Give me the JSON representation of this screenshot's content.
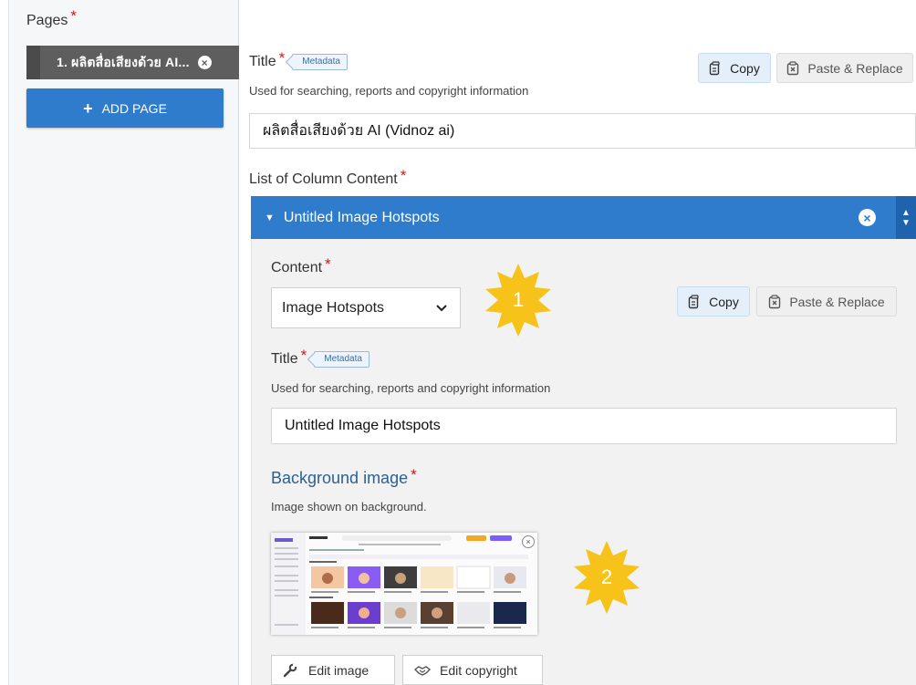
{
  "sidebar": {
    "pages_label": "Pages",
    "required_mark": "*",
    "page_items": [
      {
        "label": "1. ผลิตสื่อเสียงด้วย AI...",
        "close_icon": "×"
      }
    ],
    "add_page_icon": "+",
    "add_page_label": "ADD PAGE"
  },
  "title_field": {
    "label": "Title",
    "required_mark": "*",
    "metadata_tag": "Metadata",
    "help": "Used for searching, reports and copyright information",
    "value": "ผลิตสื่อเสียงด้วย AI (Vidnoz ai)",
    "copy_label": "Copy",
    "paste_label": "Paste & Replace"
  },
  "column_content": {
    "label": "List of Column Content",
    "required_mark": "*",
    "group_caret": "▼",
    "group_title": "Untitled Image Hotspots",
    "close_icon": "×",
    "up_icon": "▲",
    "down_icon": "▼",
    "content_label": "Content",
    "content_select_value": "Image Hotspots",
    "content_select_caret": "⌄",
    "copy_label": "Copy",
    "paste_label": "Paste & Replace",
    "title_label": "Title",
    "metadata_tag": "Metadata",
    "title_help": "Used for searching, reports and copyright information",
    "title_value": "Untitled Image Hotspots",
    "bg_label": "Background image",
    "bg_help": "Image shown on background.",
    "thumb_close": "×",
    "edit_image_label": "Edit image",
    "edit_copyright_label": "Edit copyright"
  },
  "badges": [
    {
      "number": "1",
      "color": "#f7c21a"
    },
    {
      "number": "2",
      "color": "#f7c21a"
    }
  ],
  "colors": {
    "primary": "#2f7ccd",
    "tab_dark": "#5e5e5e",
    "required": "#d8131a"
  }
}
